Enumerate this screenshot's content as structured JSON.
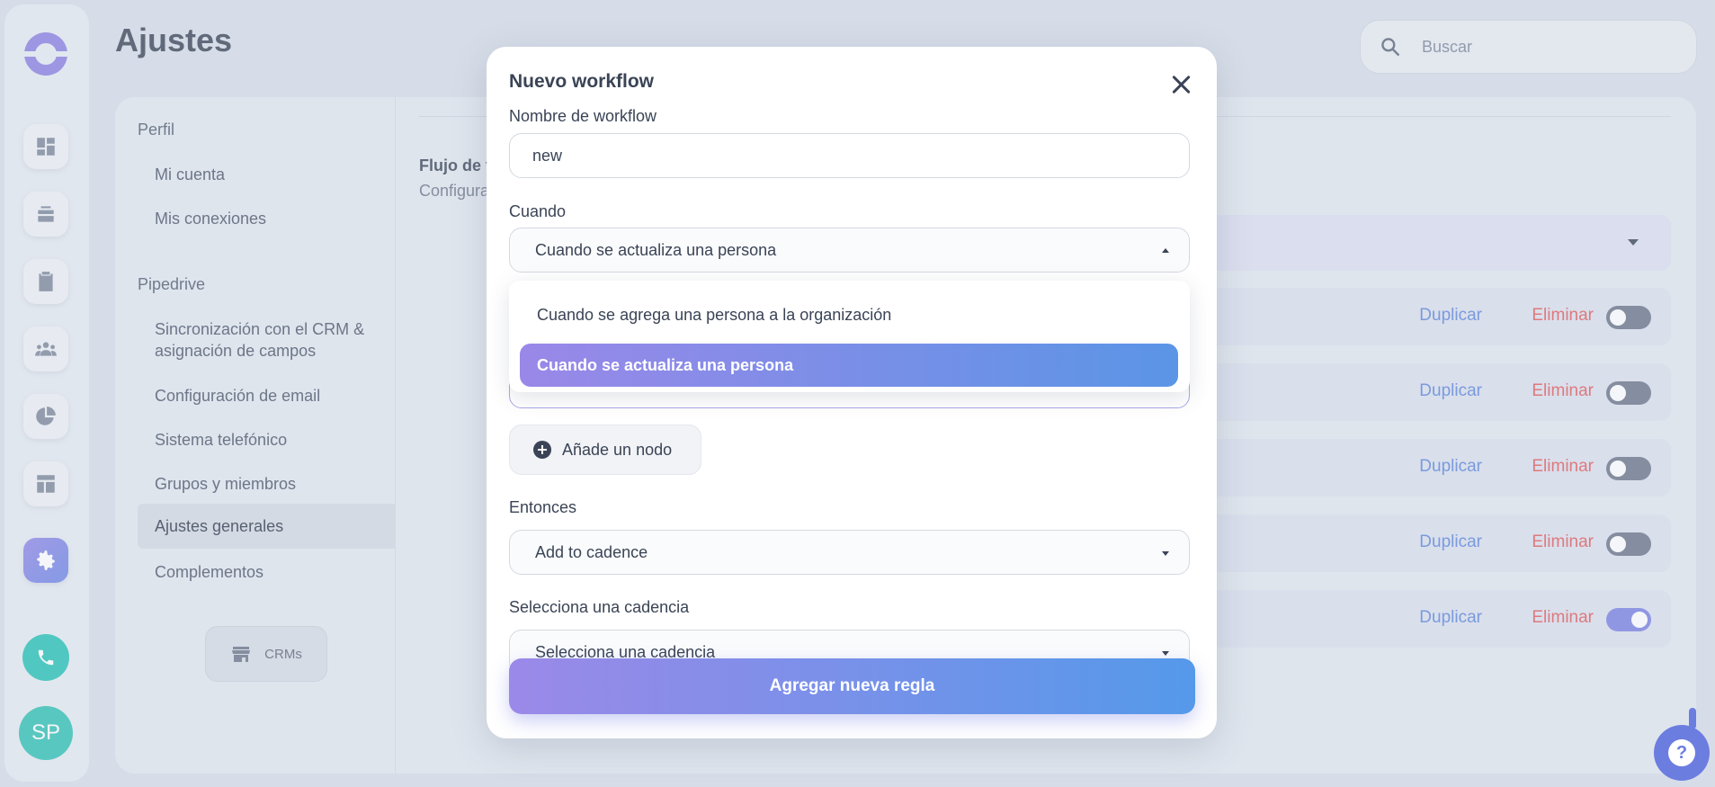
{
  "header": {
    "title": "Ajustes",
    "search_placeholder": "Buscar"
  },
  "rail": {
    "items": [
      "dashboard-icon",
      "layers-icon",
      "clipboard-icon",
      "people-icon",
      "pie-chart-icon",
      "layout-icon",
      "gear-icon"
    ],
    "phone_icon": "phone-icon",
    "avatar_initials": "SP"
  },
  "settings_nav": {
    "groups": [
      {
        "label": "Perfil",
        "items": [
          "Mi cuenta",
          "Mis conexiones"
        ]
      },
      {
        "label": "Pipedrive",
        "items": [
          "Sincronización con el CRM & asignación de campos",
          "Configuración de email",
          "Sistema telefónico",
          "Grupos y miembros",
          "Ajustes generales",
          "Complementos"
        ]
      }
    ],
    "active_item": "Ajustes generales",
    "crms_label": "CRMs"
  },
  "content": {
    "title_partial": "Flujo de t",
    "subtitle_partial": "Configura",
    "rows": [
      {
        "duplicate": "Duplicar",
        "delete": "Eliminar",
        "enabled": false
      },
      {
        "duplicate": "Duplicar",
        "delete": "Eliminar",
        "enabled": false
      },
      {
        "duplicate": "Duplicar",
        "delete": "Eliminar",
        "enabled": false
      },
      {
        "duplicate": "Duplicar",
        "delete": "Eliminar",
        "enabled": false
      },
      {
        "duplicate": "Duplicar",
        "delete": "Eliminar",
        "enabled": true
      }
    ]
  },
  "modal": {
    "title": "Nuevo workflow",
    "name_label": "Nombre de workflow",
    "name_value": "new",
    "when_label": "Cuando",
    "when_value": "Cuando se actualiza una persona",
    "when_options": [
      "Cuando se agrega una persona a la organización",
      "Cuando se actualiza una persona"
    ],
    "add_node_label": "Añade un nodo",
    "then_label": "Entonces",
    "then_value": "Add to cadence",
    "cadence_label": "Selecciona una cadencia",
    "cadence_value": "Selecciona una cadencia",
    "submit_label": "Agregar nueva regla"
  },
  "colors": {
    "accent_start": "#9a88e8",
    "accent_end": "#5b95e6",
    "danger": "#e05a5a",
    "link": "#5b86d9"
  }
}
